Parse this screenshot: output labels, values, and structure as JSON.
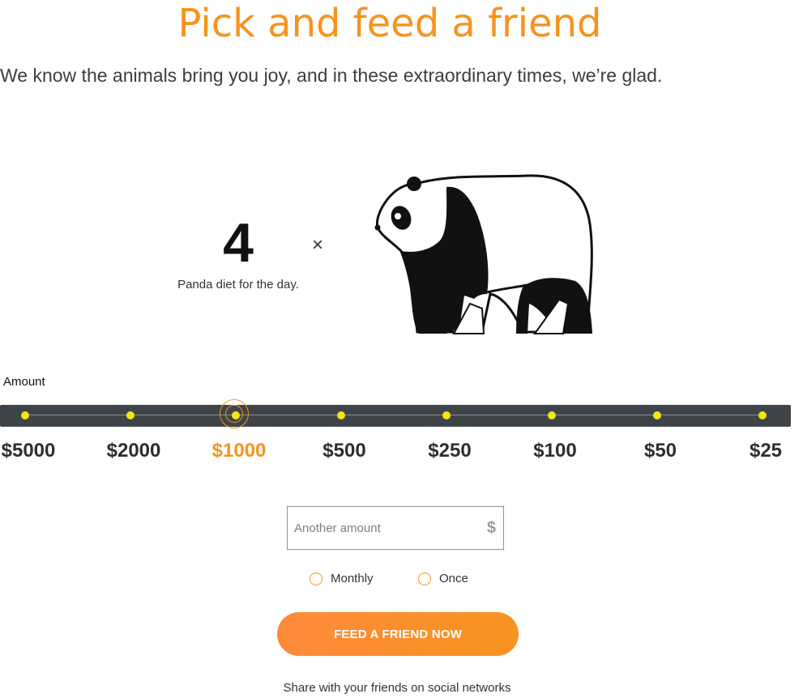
{
  "page": {
    "title": "Pick and feed a friend",
    "subtitle": "We know the animals bring you joy, and in these extraordinary times, we’re glad."
  },
  "feed_summary": {
    "count": "4",
    "multiplier_symbol": "×",
    "diet_label": "Panda diet for the day.",
    "animal_icon": "panda-icon"
  },
  "amount": {
    "label": "Amount",
    "selected": "$1000",
    "options": [
      {
        "label": "$5000"
      },
      {
        "label": "$2000"
      },
      {
        "label": "$1000"
      },
      {
        "label": "$500"
      },
      {
        "label": "$250"
      },
      {
        "label": "$100"
      },
      {
        "label": "$50"
      },
      {
        "label": "$25"
      }
    ],
    "other_placeholder": "Another amount",
    "currency_symbol": "$"
  },
  "frequency": {
    "options": [
      {
        "label": "Monthly"
      },
      {
        "label": "Once"
      }
    ]
  },
  "cta": {
    "label": "FEED A FRIEND NOW"
  },
  "share": {
    "text": "Share with your friends on social networks"
  },
  "colors": {
    "accent": "#f7931e",
    "track": "#3f4449",
    "stop": "#f5e516",
    "text": "#2b2f33"
  }
}
